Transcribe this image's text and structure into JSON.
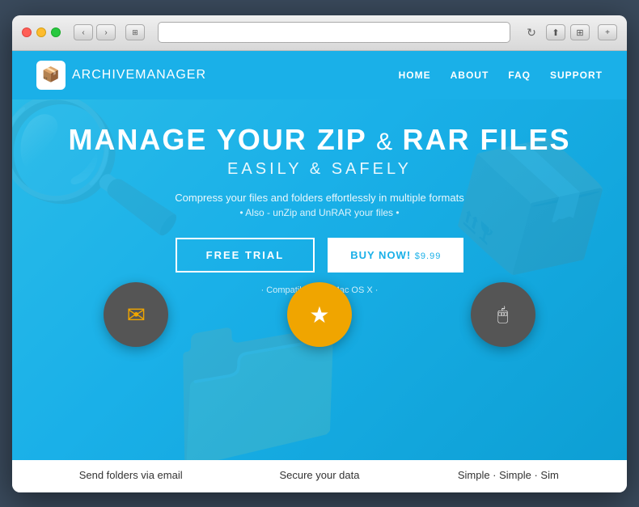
{
  "browser": {
    "traffic_lights": [
      "red",
      "yellow",
      "green"
    ],
    "back_label": "‹",
    "forward_label": "›",
    "window_label": "⊞",
    "reload_label": "↻",
    "share_label": "⬆",
    "new_tab_label": "⊞",
    "expand_label": "+"
  },
  "site": {
    "logo_icon": "📦",
    "logo_bold": "ARCHIVE",
    "logo_light": "MANAGER",
    "nav": {
      "items": [
        {
          "label": "HOME"
        },
        {
          "label": "ABOUT"
        },
        {
          "label": "FAQ"
        },
        {
          "label": "SUPPORT"
        }
      ]
    }
  },
  "hero": {
    "title_line1": "MANAGE YOUR ZIP",
    "title_amp": "&",
    "title_line2": "RAR FILES",
    "subtitle": "EASILY",
    "subtitle_amp": "&",
    "subtitle_end": "SAFELY",
    "description": "Compress your files and folders effortlessly in multiple formats",
    "sub_description": "• Also - unZip and UnRAR your files •",
    "free_trial_label": "FREE TRIAL",
    "buy_now_label": "BUY NOW!",
    "buy_now_price": "$9.99",
    "compatible_text": "· Compatible with Mac OS X ·"
  },
  "features": [
    {
      "icon": "✉",
      "icon_color": "dark",
      "label": "Send folders via email"
    },
    {
      "icon": "★",
      "icon_color": "orange",
      "label": "Secure your data"
    },
    {
      "icon": "🖱",
      "icon_color": "dark",
      "label": "Simple · Simple · Sim"
    }
  ]
}
